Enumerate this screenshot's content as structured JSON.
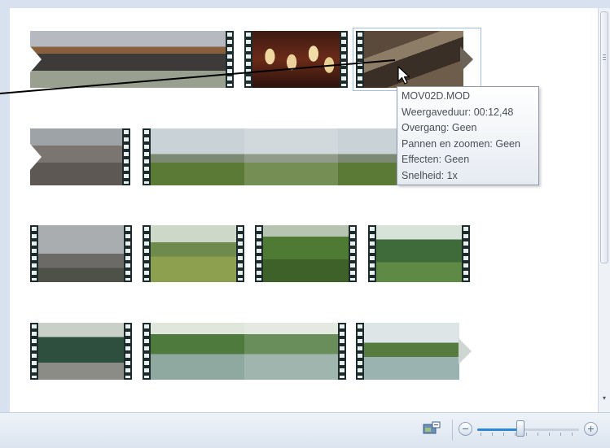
{
  "storyboard": {
    "clips": [
      {
        "name": "clip-1"
      },
      {
        "name": "clip-2"
      },
      {
        "name": "clip-3"
      },
      {
        "name": "clip-4"
      },
      {
        "name": "clip-5"
      },
      {
        "name": "clip-6"
      },
      {
        "name": "clip-7"
      },
      {
        "name": "clip-8"
      },
      {
        "name": "clip-9"
      },
      {
        "name": "clip-10"
      },
      {
        "name": "clip-11"
      },
      {
        "name": "clip-12"
      }
    ]
  },
  "tooltip": {
    "filename": "MOV02D.MOD",
    "duration": "Weergaveduur: 00:12,48",
    "transition": "Overgang: Geen",
    "pan_zoom": "Pannen en zoomen: Geen",
    "effects": "Effecten: Geen",
    "speed": "Snelheid: 1x"
  },
  "toolbar": {
    "zoom_out_symbol": "−",
    "zoom_in_symbol": "+",
    "zoom_level": 0.42,
    "thumbnail_icon": "thumbnail-size-icon"
  },
  "colors": {
    "accent": "#2d86d6",
    "tooltip_border": "#8e9aab",
    "film_sprocket": "#1d2b2c"
  }
}
